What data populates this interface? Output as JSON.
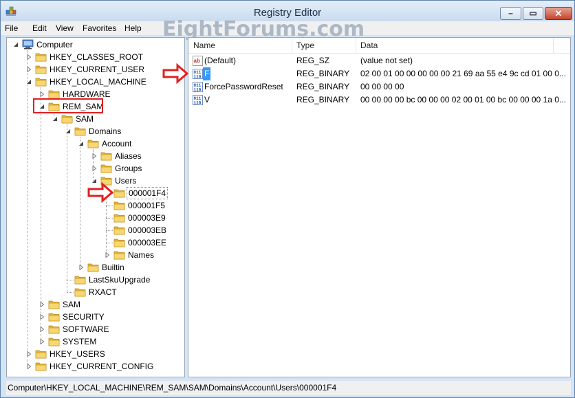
{
  "window": {
    "title": "Registry Editor",
    "minimize_glyph": "–",
    "maximize_glyph": "▭",
    "close_glyph": "✕"
  },
  "watermark": "EightForums.com",
  "menu": [
    "File",
    "Edit",
    "View",
    "Favorites",
    "Help"
  ],
  "tree": [
    {
      "label": "Computer",
      "depth": 0,
      "expander": "expanded",
      "icon": "computer-icon"
    },
    {
      "label": "HKEY_CLASSES_ROOT",
      "depth": 1,
      "expander": "collapsed",
      "icon": "folder-icon"
    },
    {
      "label": "HKEY_CURRENT_USER",
      "depth": 1,
      "expander": "collapsed",
      "icon": "folder-icon"
    },
    {
      "label": "HKEY_LOCAL_MACHINE",
      "depth": 1,
      "expander": "expanded",
      "icon": "folder-icon"
    },
    {
      "label": "HARDWARE",
      "depth": 2,
      "expander": "collapsed",
      "icon": "folder-icon"
    },
    {
      "label": "REM_SAM",
      "depth": 2,
      "expander": "expanded",
      "icon": "folder-icon",
      "highlight": true
    },
    {
      "label": "SAM",
      "depth": 3,
      "expander": "expanded",
      "icon": "folder-icon"
    },
    {
      "label": "Domains",
      "depth": 4,
      "expander": "expanded",
      "icon": "folder-icon"
    },
    {
      "label": "Account",
      "depth": 5,
      "expander": "expanded",
      "icon": "folder-icon"
    },
    {
      "label": "Aliases",
      "depth": 6,
      "expander": "collapsed",
      "icon": "folder-icon"
    },
    {
      "label": "Groups",
      "depth": 6,
      "expander": "collapsed",
      "icon": "folder-icon"
    },
    {
      "label": "Users",
      "depth": 6,
      "expander": "expanded",
      "icon": "folder-icon"
    },
    {
      "label": "000001F4",
      "depth": 7,
      "expander": "none",
      "icon": "folder-icon",
      "selected": true,
      "arrow": true
    },
    {
      "label": "000001F5",
      "depth": 7,
      "expander": "none",
      "icon": "folder-icon"
    },
    {
      "label": "000003E9",
      "depth": 7,
      "expander": "none",
      "icon": "folder-icon"
    },
    {
      "label": "000003EB",
      "depth": 7,
      "expander": "none",
      "icon": "folder-icon"
    },
    {
      "label": "000003EE",
      "depth": 7,
      "expander": "none",
      "icon": "folder-icon"
    },
    {
      "label": "Names",
      "depth": 7,
      "expander": "collapsed",
      "icon": "folder-icon"
    },
    {
      "label": "Builtin",
      "depth": 5,
      "expander": "collapsed",
      "icon": "folder-icon"
    },
    {
      "label": "LastSkuUpgrade",
      "depth": 4,
      "expander": "none",
      "icon": "folder-icon"
    },
    {
      "label": "RXACT",
      "depth": 4,
      "expander": "none",
      "icon": "folder-icon"
    },
    {
      "label": "SAM",
      "depth": 2,
      "expander": "collapsed",
      "icon": "folder-icon"
    },
    {
      "label": "SECURITY",
      "depth": 2,
      "expander": "collapsed",
      "icon": "folder-icon"
    },
    {
      "label": "SOFTWARE",
      "depth": 2,
      "expander": "collapsed",
      "icon": "folder-icon"
    },
    {
      "label": "SYSTEM",
      "depth": 2,
      "expander": "collapsed",
      "icon": "folder-icon"
    },
    {
      "label": "HKEY_USERS",
      "depth": 1,
      "expander": "collapsed",
      "icon": "folder-icon"
    },
    {
      "label": "HKEY_CURRENT_CONFIG",
      "depth": 1,
      "expander": "collapsed",
      "icon": "folder-icon"
    }
  ],
  "columns": [
    "Name",
    "Type",
    "Data"
  ],
  "values": [
    {
      "name": "(Default)",
      "type": "REG_SZ",
      "data": "(value not set)",
      "icon": "string-value-icon"
    },
    {
      "name": "F",
      "type": "REG_BINARY",
      "data": "02 00 01 00 00 00 00 00 21 69 aa 55 e4 9c cd 01 00 0...",
      "icon": "binary-value-icon",
      "selected": true,
      "arrow": true
    },
    {
      "name": "ForcePasswordReset",
      "type": "REG_BINARY",
      "data": "00 00 00 00",
      "icon": "binary-value-icon"
    },
    {
      "name": "V",
      "type": "REG_BINARY",
      "data": "00 00 00 00 bc 00 00 00 02 00 01 00 bc 00 00 00 1a 0...",
      "icon": "binary-value-icon"
    }
  ],
  "status": "Computer\\HKEY_LOCAL_MACHINE\\REM_SAM\\SAM\\Domains\\Account\\Users\\000001F4",
  "colors": {
    "selection": "#3399ff",
    "annotation": "#e02020",
    "folder": "#f2c94c"
  }
}
